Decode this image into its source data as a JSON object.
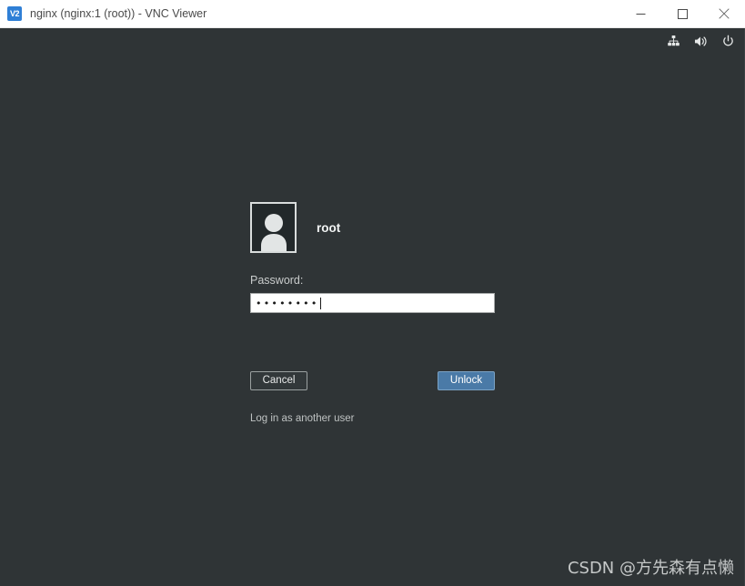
{
  "window": {
    "app_icon": "vnc-viewer-icon",
    "app_icon_label": "V2",
    "title": "nginx (nginx:1 (root)) - VNC Viewer",
    "controls": {
      "minimize": "minimize-icon",
      "maximize": "maximize-icon",
      "close": "close-icon"
    }
  },
  "desktop": {
    "background_color": "#2f3436",
    "tray": [
      {
        "name": "network-icon",
        "title": "Network"
      },
      {
        "name": "volume-icon",
        "title": "Volume"
      },
      {
        "name": "power-icon",
        "title": "Power"
      }
    ]
  },
  "lock_screen": {
    "avatar_name": "user-avatar",
    "username": "root",
    "password_label": "Password:",
    "password_value": "••••••••",
    "password_placeholder": "",
    "password_char_count": 8,
    "cancel_label": "Cancel",
    "unlock_label": "Unlock",
    "unlock_color": "#4a7aa7",
    "other_user_label": "Log in as another user"
  },
  "watermark": {
    "text": "CSDN @方先森有点懒"
  }
}
